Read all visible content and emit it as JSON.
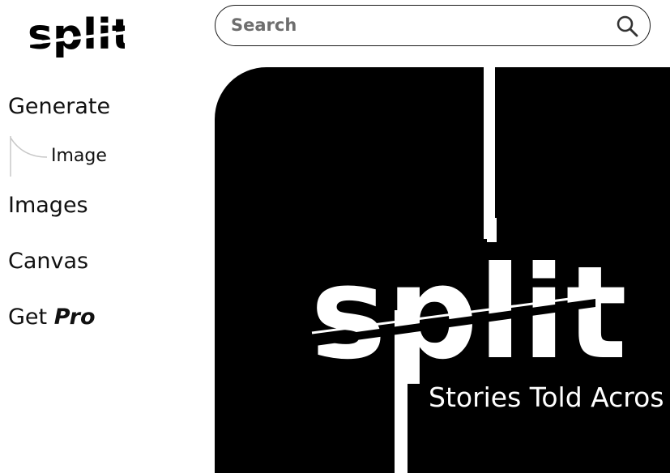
{
  "brand": {
    "logo_text": "split"
  },
  "search": {
    "placeholder": "Search",
    "value": ""
  },
  "sidebar": {
    "generate": "Generate",
    "generate_sub": [
      "Image"
    ],
    "images": "Images",
    "canvas": "Canvas",
    "get_pro_prefix": "Get",
    "get_pro_emphasis": "Pro"
  },
  "hero": {
    "logo_text": "split",
    "tagline": "Stories Told Acros"
  },
  "icons": {
    "search": "search-icon",
    "tree_connector": "tree-connector-icon"
  },
  "colors": {
    "hero_bg": "#000000",
    "text": "#111111",
    "placeholder": "#6e6e6e"
  }
}
